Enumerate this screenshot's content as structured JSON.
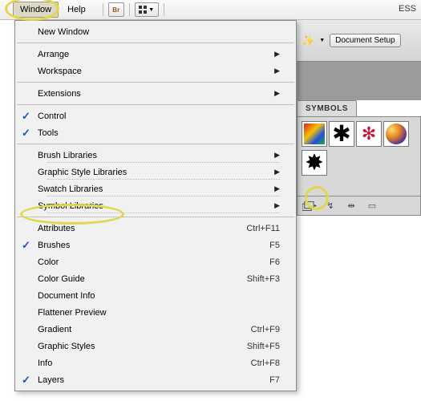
{
  "menubar": {
    "window": "Window",
    "help": "Help",
    "br": "Br",
    "ess": "ESS"
  },
  "secondbar": {
    "doc_setup": "Document Setup"
  },
  "panel": {
    "tab": "SYMBOLS"
  },
  "dropdown": {
    "new_window": "New Window",
    "arrange": "Arrange",
    "workspace": "Workspace",
    "extensions": "Extensions",
    "control": "Control",
    "tools": "Tools",
    "brush_libs": "Brush Libraries",
    "gstyle_libs": "Graphic Style Libraries",
    "swatch_libs": "Swatch Libraries",
    "symbol_libs": "Symbol Libraries",
    "attributes": "Attributes",
    "brushes": "Brushes",
    "color": "Color",
    "color_guide": "Color Guide",
    "doc_info": "Document Info",
    "flattener": "Flattener Preview",
    "gradient": "Gradient",
    "gstyles": "Graphic Styles",
    "info": "Info",
    "layers": "Layers"
  },
  "shortcuts": {
    "attributes": "Ctrl+F11",
    "brushes": "F5",
    "color": "F6",
    "color_guide": "Shift+F3",
    "gradient": "Ctrl+F9",
    "gstyles": "Shift+F5",
    "info": "Ctrl+F8",
    "layers": "F7"
  }
}
